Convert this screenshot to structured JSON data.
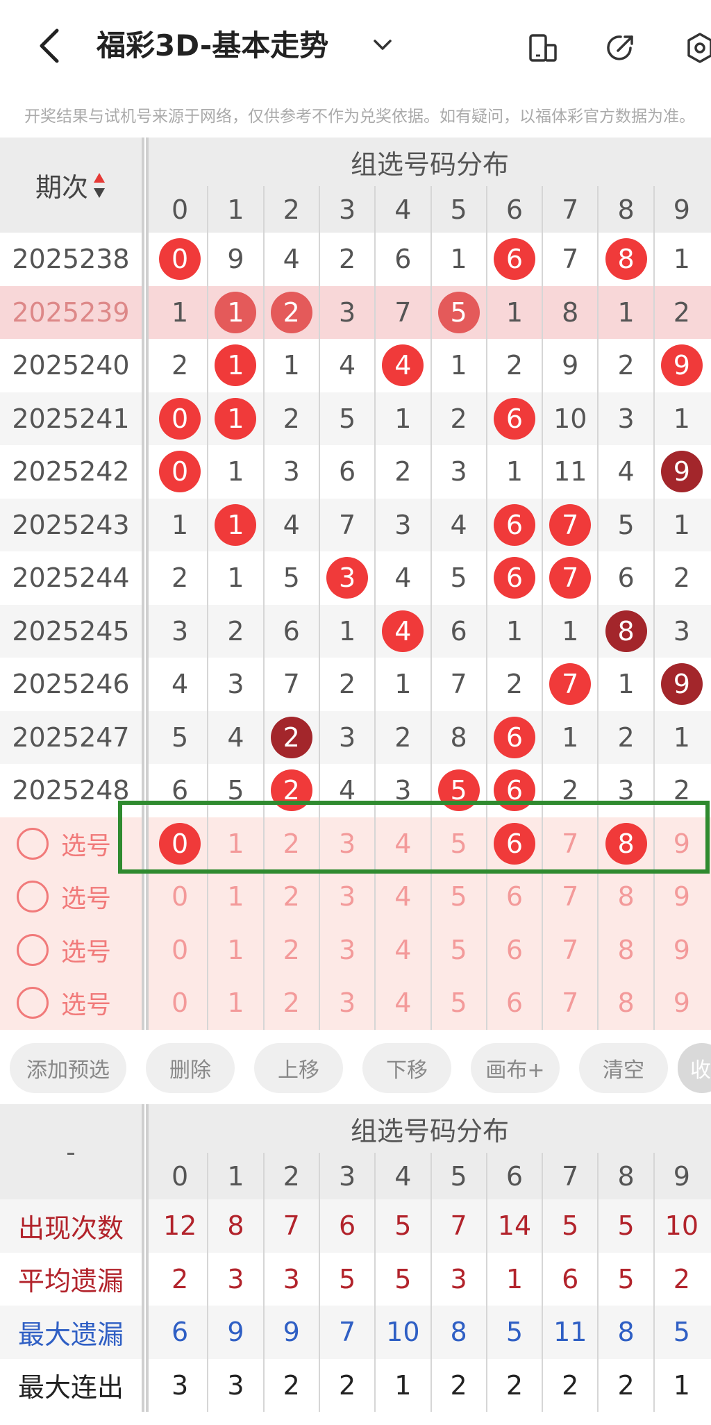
{
  "header": {
    "title": "福彩3D-基本走势",
    "disclaimer": "开奖结果与试机号来源于网络，仅供参考不作为兑奖依据。如有疑问，以福体彩官方数据为准。"
  },
  "table": {
    "period_header": "期次",
    "group_header": "组选号码分布",
    "digits": [
      "0",
      "1",
      "2",
      "3",
      "4",
      "5",
      "6",
      "7",
      "8",
      "9"
    ],
    "rows": [
      {
        "period": "2025238",
        "cells": [
          "0",
          "9",
          "4",
          "2",
          "6",
          "1",
          "6",
          "7",
          "8",
          "1"
        ],
        "balls": [
          0,
          6,
          8
        ],
        "dark": []
      },
      {
        "period": "2025239",
        "cells": [
          "1",
          "1",
          "2",
          "3",
          "7",
          "5",
          "1",
          "8",
          "1",
          "2"
        ],
        "balls": [
          1,
          2,
          5
        ],
        "dark": [],
        "highlight": true
      },
      {
        "period": "2025240",
        "cells": [
          "2",
          "1",
          "1",
          "4",
          "4",
          "1",
          "2",
          "9",
          "2",
          "9"
        ],
        "balls": [
          1,
          4,
          9
        ],
        "dark": []
      },
      {
        "period": "2025241",
        "cells": [
          "0",
          "1",
          "2",
          "5",
          "1",
          "2",
          "6",
          "10",
          "3",
          "1"
        ],
        "balls": [
          0,
          1,
          6
        ],
        "dark": []
      },
      {
        "period": "2025242",
        "cells": [
          "0",
          "1",
          "3",
          "6",
          "2",
          "3",
          "1",
          "11",
          "4",
          "9"
        ],
        "balls": [
          0,
          9
        ],
        "dark": [
          9
        ]
      },
      {
        "period": "2025243",
        "cells": [
          "1",
          "1",
          "4",
          "7",
          "3",
          "4",
          "6",
          "7",
          "5",
          "1"
        ],
        "balls": [
          1,
          6,
          7
        ],
        "dark": []
      },
      {
        "period": "2025244",
        "cells": [
          "2",
          "1",
          "5",
          "3",
          "4",
          "5",
          "6",
          "7",
          "6",
          "2"
        ],
        "balls": [
          3,
          6,
          7
        ],
        "dark": []
      },
      {
        "period": "2025245",
        "cells": [
          "3",
          "2",
          "6",
          "1",
          "4",
          "6",
          "1",
          "1",
          "8",
          "3"
        ],
        "balls": [
          4,
          8
        ],
        "dark": [
          8
        ]
      },
      {
        "period": "2025246",
        "cells": [
          "4",
          "3",
          "7",
          "2",
          "1",
          "7",
          "2",
          "7",
          "1",
          "9"
        ],
        "balls": [
          7,
          9
        ],
        "dark": [
          9
        ]
      },
      {
        "period": "2025247",
        "cells": [
          "5",
          "4",
          "2",
          "3",
          "2",
          "8",
          "6",
          "1",
          "2",
          "1"
        ],
        "balls": [
          2,
          6
        ],
        "dark": [
          2
        ]
      },
      {
        "period": "2025248",
        "cells": [
          "6",
          "5",
          "2",
          "4",
          "3",
          "5",
          "6",
          "2",
          "3",
          "2"
        ],
        "balls": [
          2,
          5,
          6
        ],
        "dark": []
      }
    ]
  },
  "picks": {
    "label": "选号",
    "rows": [
      {
        "selected": [
          0,
          6,
          8
        ]
      },
      {
        "selected": []
      },
      {
        "selected": []
      },
      {
        "selected": []
      }
    ]
  },
  "toolbar": {
    "add": "添加预选",
    "delete": "删除",
    "up": "上移",
    "down": "下移",
    "canvas": "画布+",
    "clear": "清空",
    "collapse": "收"
  },
  "stats": {
    "corner": "-",
    "group_header": "组选号码分布",
    "rows": [
      {
        "label": "出现次数",
        "color": "#b2232b",
        "values": [
          "12",
          "8",
          "7",
          "6",
          "5",
          "7",
          "14",
          "5",
          "5",
          "10"
        ]
      },
      {
        "label": "平均遗漏",
        "color": "#b2232b",
        "values": [
          "2",
          "3",
          "3",
          "5",
          "5",
          "3",
          "1",
          "6",
          "5",
          "2"
        ]
      },
      {
        "label": "最大遗漏",
        "color": "#2f5fc4",
        "values": [
          "6",
          "9",
          "9",
          "7",
          "10",
          "8",
          "5",
          "11",
          "8",
          "5"
        ]
      },
      {
        "label": "最大连出",
        "color": "#222222",
        "values": [
          "3",
          "3",
          "2",
          "2",
          "1",
          "2",
          "2",
          "2",
          "2",
          "1"
        ]
      }
    ]
  }
}
